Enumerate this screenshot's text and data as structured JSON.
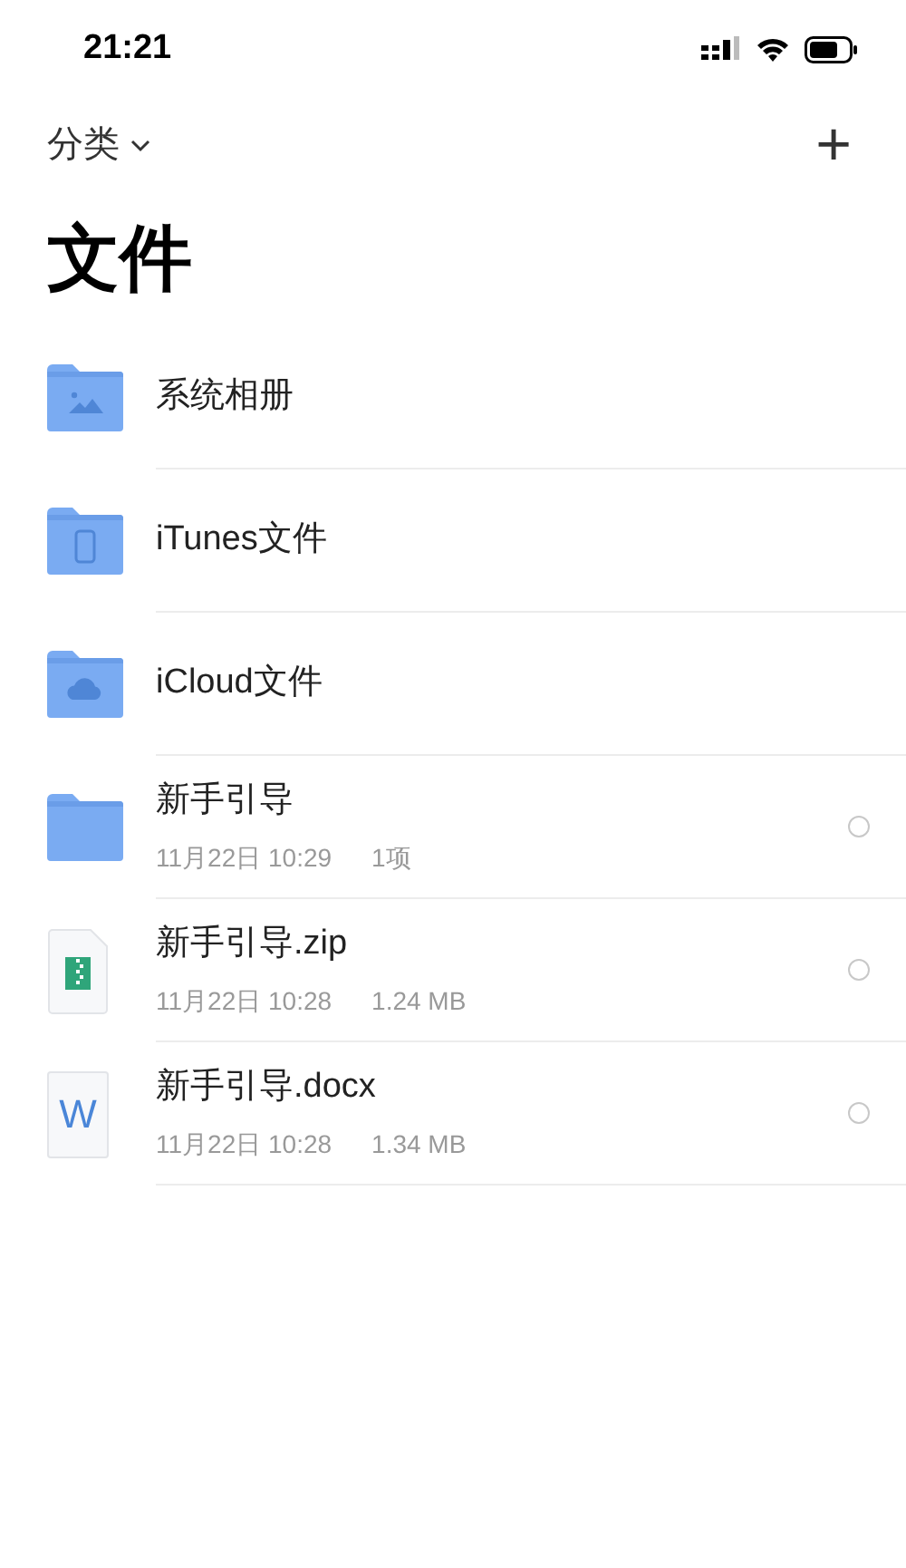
{
  "status_bar": {
    "time": "21:21"
  },
  "nav": {
    "category_label": "分类",
    "add_button": "+"
  },
  "title": "文件",
  "items": [
    {
      "kind": "photos",
      "name": "系统相册"
    },
    {
      "kind": "phone",
      "name": "iTunes文件"
    },
    {
      "kind": "cloud",
      "name": "iCloud文件"
    },
    {
      "kind": "folder",
      "name": "新手引导",
      "date": "11月22日 10:29",
      "info": "1项",
      "selected": false
    },
    {
      "kind": "zip",
      "name": "新手引导.zip",
      "date": "11月22日 10:28",
      "info": "1.24 MB",
      "selected": false
    },
    {
      "kind": "doc",
      "name": "新手引导.docx",
      "date": "11月22日 10:28",
      "info": "1.34 MB",
      "selected": false,
      "icon_letter": "W"
    }
  ]
}
